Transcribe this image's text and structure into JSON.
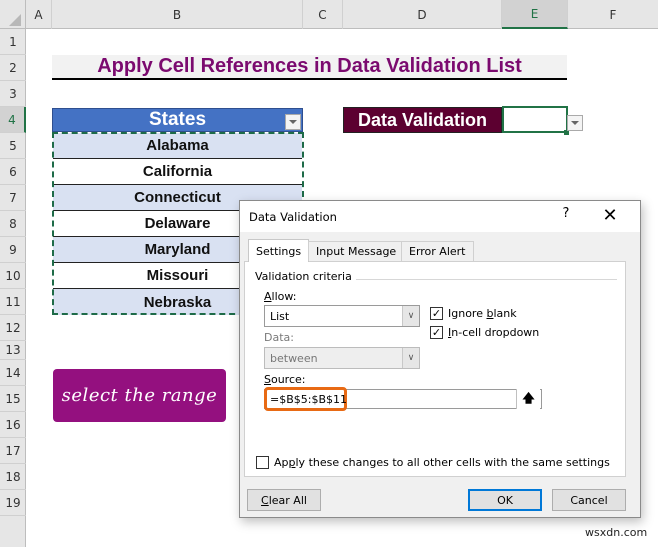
{
  "spreadsheet": {
    "columns": [
      "A",
      "B",
      "C",
      "D",
      "E",
      "F"
    ],
    "selected_column": "E",
    "rows": [
      "1",
      "2",
      "3",
      "4",
      "5",
      "6",
      "7",
      "8",
      "9",
      "10",
      "11",
      "12",
      "13",
      "14",
      "15",
      "16",
      "17",
      "18",
      "19"
    ],
    "selected_row": "4",
    "title": "Apply Cell References in Data Validation List",
    "table": {
      "header": "States",
      "values": [
        "Alabama",
        "California",
        "Connecticut",
        "Delaware",
        "Maryland",
        "Missouri",
        "Nebraska"
      ]
    },
    "dv_label": "Data Validation",
    "dv_cell_value": "",
    "callout": "select the range"
  },
  "dialog": {
    "title": "Data Validation",
    "help_label": "?",
    "close_label": "✕",
    "tabs": [
      {
        "label": "Settings",
        "active": true
      },
      {
        "label": "Input Message",
        "active": false
      },
      {
        "label": "Error Alert",
        "active": false
      }
    ],
    "group_label": "Validation criteria",
    "allow": {
      "label": "Allow:",
      "value": "List"
    },
    "data": {
      "label": "Data:",
      "value": "between"
    },
    "ignore_blank": {
      "label": "Ignore blank",
      "checked": true
    },
    "in_cell_dropdown": {
      "label": "In-cell dropdown",
      "checked": true
    },
    "source": {
      "label": "Source:",
      "value": "=$B$5:$B$11"
    },
    "apply_all": {
      "label": "Apply these changes to all other cells with the same settings",
      "checked": false
    },
    "buttons": {
      "clear_all": "Clear All",
      "ok": "OK",
      "cancel": "Cancel"
    }
  },
  "watermark": "wsxdn.com",
  "colors": {
    "title_text": "#7b0a6f",
    "table_header": "#4472c4",
    "table_alt_row": "#d9e1f2",
    "dv_label_bg": "#5c0030",
    "callout_bg": "#94107f",
    "source_highlight": "#e86a14",
    "selection_green": "#217346"
  }
}
